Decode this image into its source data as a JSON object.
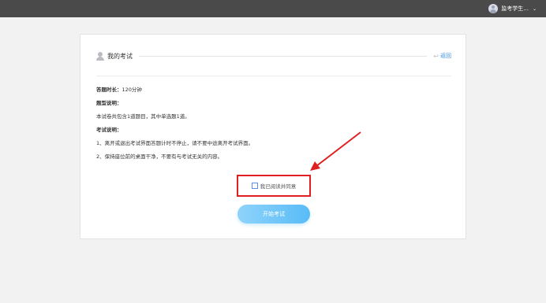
{
  "topbar": {
    "user_name": "监考学生...",
    "dropdown_icon": "chevron-down-icon"
  },
  "card": {
    "title": "我的考试",
    "back_label": "返回",
    "lines": [
      {
        "text": "答题时长：120分钟",
        "bold_prefix": "答题时长："
      },
      {
        "text": "题型说明："
      },
      {
        "text": "本试卷共包含1道题目，其中单选题1道。"
      },
      {
        "text": "考试说明："
      },
      {
        "text": "1、离开或退出考试界面答题计时不停止，请不要中途离开考试界面。"
      },
      {
        "text": "2、保持座位前的桌面干净，不要有与考试无关的内容。"
      }
    ]
  },
  "agree_label": "我已阅读并同意",
  "start_label": "开始考试",
  "colors": {
    "topbar": "#4a4a4a",
    "accent": "#59bcf7",
    "highlight": "#e02020",
    "link": "#3a8ee6"
  }
}
